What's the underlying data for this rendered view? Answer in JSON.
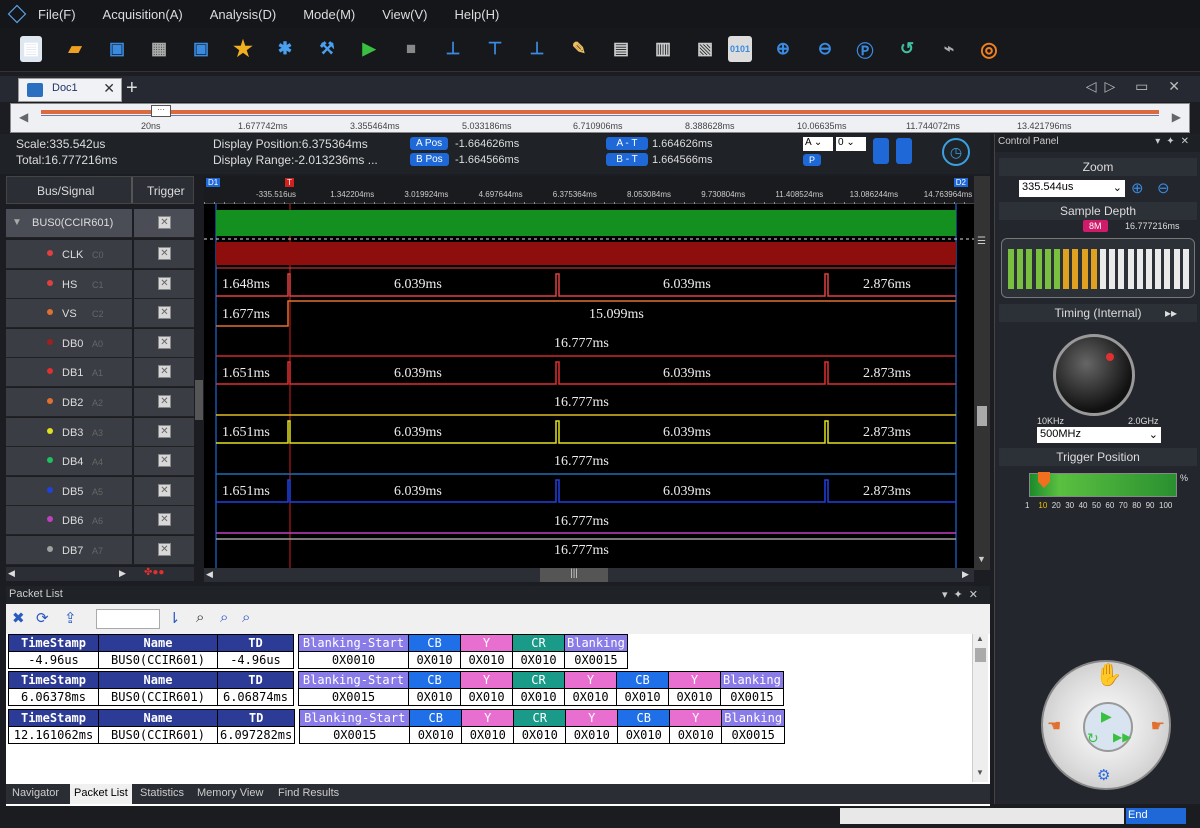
{
  "menu": [
    "File(F)",
    "Acquisition(A)",
    "Analysis(D)",
    "Mode(M)",
    "View(V)",
    "Help(H)"
  ],
  "toolbar_icons": [
    "new-icon",
    "open-icon",
    "save-icon",
    "print-icon",
    "save-settings-icon",
    "star-icon",
    "wizard-icon",
    "tools-icon",
    "run-icon",
    "stop-icon",
    "cursor-a-icon",
    "cursor-b-icon",
    "cursor-c-icon",
    "flashlight-icon",
    "export-icon",
    "decode-icon",
    "compare-icon",
    "binary-icon",
    "zoom-in-icon",
    "zoom-out-icon",
    "zoom-fit-icon",
    "refresh-icon",
    "probe-icon",
    "help-ring-icon"
  ],
  "doc_tab": "Doc1",
  "overview": {
    "labels": [
      "20ns",
      "1.677742ms",
      "3.355464ms",
      "5.033186ms",
      "6.710906ms",
      "8.388628ms",
      "10.06635ms",
      "11.744072ms",
      "13.421796ms"
    ]
  },
  "info": {
    "scale": "Scale:335.542us",
    "total": "Total:16.777216ms",
    "display_position": "Display Position:6.375364ms",
    "display_range": "Display Range:-2.013236ms ...",
    "a_pos_label": "A Pos",
    "a_pos_value": "-1.664626ms",
    "b_pos_label": "B Pos",
    "b_pos_value": "-1.664566ms",
    "a_t_label": "A - T",
    "a_t_value": "1.664626ms",
    "b_t_label": "B - T",
    "b_t_value": "1.664566ms",
    "sel_a": "A",
    "sel_b": "0",
    "p_label": "P"
  },
  "signals": {
    "header_bus": "Bus/Signal",
    "header_trigger": "Trigger",
    "bus": "BUS0(CCIR601)",
    "rows": [
      {
        "name": "CLK",
        "chan": "C0",
        "color": "#e04040"
      },
      {
        "name": "HS",
        "chan": "C1",
        "color": "#e04040"
      },
      {
        "name": "VS",
        "chan": "C2",
        "color": "#e07030"
      },
      {
        "name": "DB0",
        "chan": "A0",
        "color": "#a02020"
      },
      {
        "name": "DB1",
        "chan": "A1",
        "color": "#e03030"
      },
      {
        "name": "DB2",
        "chan": "A2",
        "color": "#e07030"
      },
      {
        "name": "DB3",
        "chan": "A3",
        "color": "#e0e020"
      },
      {
        "name": "DB4",
        "chan": "A4",
        "color": "#20c060"
      },
      {
        "name": "DB5",
        "chan": "A5",
        "color": "#2040e0"
      },
      {
        "name": "DB6",
        "chan": "A6",
        "color": "#c040c0"
      },
      {
        "name": "DB7",
        "chan": "A7",
        "color": "#a0a0a0"
      }
    ]
  },
  "ruler": {
    "labels": [
      "-335.516us",
      "1.342204ms",
      "3.019924ms",
      "4.697644ms",
      "6.375364ms",
      "8.053084ms",
      "9.730804ms",
      "11.408524ms",
      "13.086244ms",
      "14.763964ms"
    ],
    "d1": "D1",
    "t": "T",
    "d2": "D2"
  },
  "wave_labels": {
    "clk_hs": [
      "1.648ms",
      "6.039ms",
      "6.039ms",
      "2.876ms"
    ],
    "vs": [
      "1.677ms",
      "15.099ms"
    ],
    "db_total": "16.777ms",
    "db_a": [
      "1.651ms",
      "6.039ms",
      "6.039ms",
      "2.873ms"
    ]
  },
  "control_panel": {
    "title": "Control Panel",
    "zoom": "Zoom",
    "zoom_value": "335.544us",
    "sample_depth": "Sample Depth",
    "depth_badge": "8M",
    "depth_value": "16.777216ms",
    "timing": "Timing (Internal)",
    "knob_min": "10KHz",
    "knob_max": "2.0GHz",
    "rate": "500MHz",
    "trigger_position": "Trigger Position",
    "trigger_scale": [
      "1",
      "10",
      "20",
      "30",
      "40",
      "50",
      "60",
      "70",
      "80",
      "90",
      "100"
    ],
    "percent": "%"
  },
  "packet_list": {
    "title": "Packet List",
    "rows": [
      {
        "header": [
          "TimeStamp",
          "Name",
          "TD"
        ],
        "values": [
          "-4.96us",
          "BUS0(CCIR601)",
          "-4.96us"
        ],
        "fields": [
          {
            "h": "Blanking-Start",
            "v": "0X0010",
            "c": "#8a7ce8"
          },
          {
            "h": "CB",
            "v": "0X010",
            "c": "#1f6fe8"
          },
          {
            "h": "Y",
            "v": "0X010",
            "c": "#e86fd0"
          },
          {
            "h": "CR",
            "v": "0X010",
            "c": "#1a9b8a"
          },
          {
            "h": "Blanking",
            "v": "0X0015",
            "c": "#8a7ce8"
          }
        ]
      },
      {
        "header": [
          "TimeStamp",
          "Name",
          "TD"
        ],
        "values": [
          "6.06378ms",
          "BUS0(CCIR601)",
          "6.06874ms"
        ],
        "fields": [
          {
            "h": "Blanking-Start",
            "v": "0X0015",
            "c": "#8a7ce8"
          },
          {
            "h": "CB",
            "v": "0X010",
            "c": "#1f6fe8"
          },
          {
            "h": "Y",
            "v": "0X010",
            "c": "#e86fd0"
          },
          {
            "h": "CR",
            "v": "0X010",
            "c": "#1a9b8a"
          },
          {
            "h": "Y",
            "v": "0X010",
            "c": "#e86fd0"
          },
          {
            "h": "CB",
            "v": "0X010",
            "c": "#1f6fe8"
          },
          {
            "h": "Y",
            "v": "0X010",
            "c": "#e86fd0"
          },
          {
            "h": "Blanking",
            "v": "0X0015",
            "c": "#8a7ce8"
          }
        ]
      },
      {
        "header": [
          "TimeStamp",
          "Name",
          "TD"
        ],
        "values": [
          "12.161062ms",
          "BUS0(CCIR601)",
          "6.097282ms"
        ],
        "fields": [
          {
            "h": "Blanking-Start",
            "v": "0X0015",
            "c": "#8a7ce8"
          },
          {
            "h": "CB",
            "v": "0X010",
            "c": "#1f6fe8"
          },
          {
            "h": "Y",
            "v": "0X010",
            "c": "#e86fd0"
          },
          {
            "h": "CR",
            "v": "0X010",
            "c": "#1a9b8a"
          },
          {
            "h": "Y",
            "v": "0X010",
            "c": "#e86fd0"
          },
          {
            "h": "CB",
            "v": "0X010",
            "c": "#1f6fe8"
          },
          {
            "h": "Y",
            "v": "0X010",
            "c": "#e86fd0"
          },
          {
            "h": "Blanking",
            "v": "0X0015",
            "c": "#8a7ce8"
          }
        ]
      }
    ]
  },
  "bottom_tabs": [
    "Navigator",
    "Packet List",
    "Statistics",
    "Memory View",
    "Find Results"
  ],
  "status": {
    "end": "End"
  }
}
